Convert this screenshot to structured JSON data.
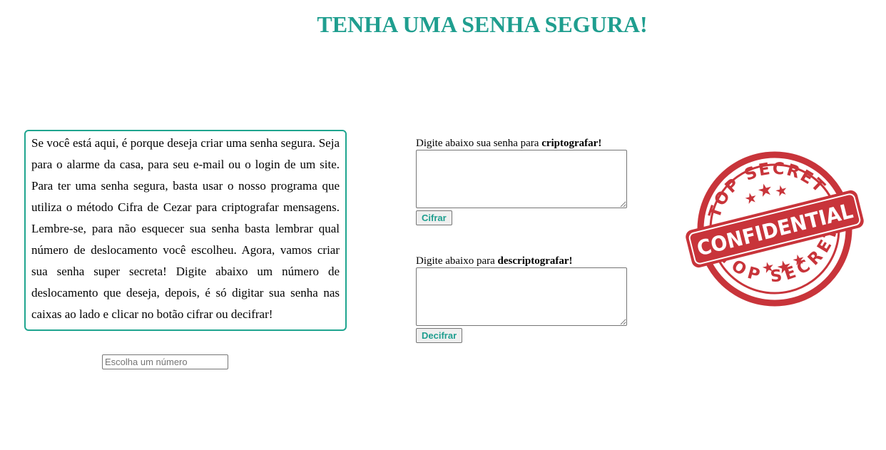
{
  "header": {
    "title": "TENHA UMA SENHA SEGURA!"
  },
  "intro": {
    "text": "Se você está aqui, é porque deseja criar uma senha segura. Seja para o alarme da casa, para seu e-mail ou o login de um site. Para ter uma senha segura, basta usar o nosso programa que utiliza o método Cifra de Cezar para criptografar mensagens. Lembre-se, para não esquecer sua senha basta lembrar qual número de deslocamento você escolheu. Agora, vamos criar sua senha super secreta! Digite abaixo um número de deslocamento que deseja, depois, é só digitar sua senha nas caixas ao lado e clicar no botão cifrar ou decifrar!"
  },
  "shift": {
    "placeholder": "Escolha um número",
    "value": ""
  },
  "encrypt": {
    "label_prefix": "Digite abaixo sua senha para ",
    "label_bold": "criptografar!",
    "textarea_value": "",
    "button_label": "Cifrar"
  },
  "decrypt": {
    "label_prefix": "Digite abaixo para ",
    "label_bold": "descriptografar!",
    "textarea_value": "",
    "button_label": "Decifrar"
  },
  "stamp": {
    "top_text": "TOP SECRET",
    "middle_text": "CONFIDENTIAL",
    "bottom_text": "TOP SECRET",
    "color": "#c8343a"
  },
  "colors": {
    "accent": "#1f9e8f",
    "border": "#1fa58f"
  }
}
